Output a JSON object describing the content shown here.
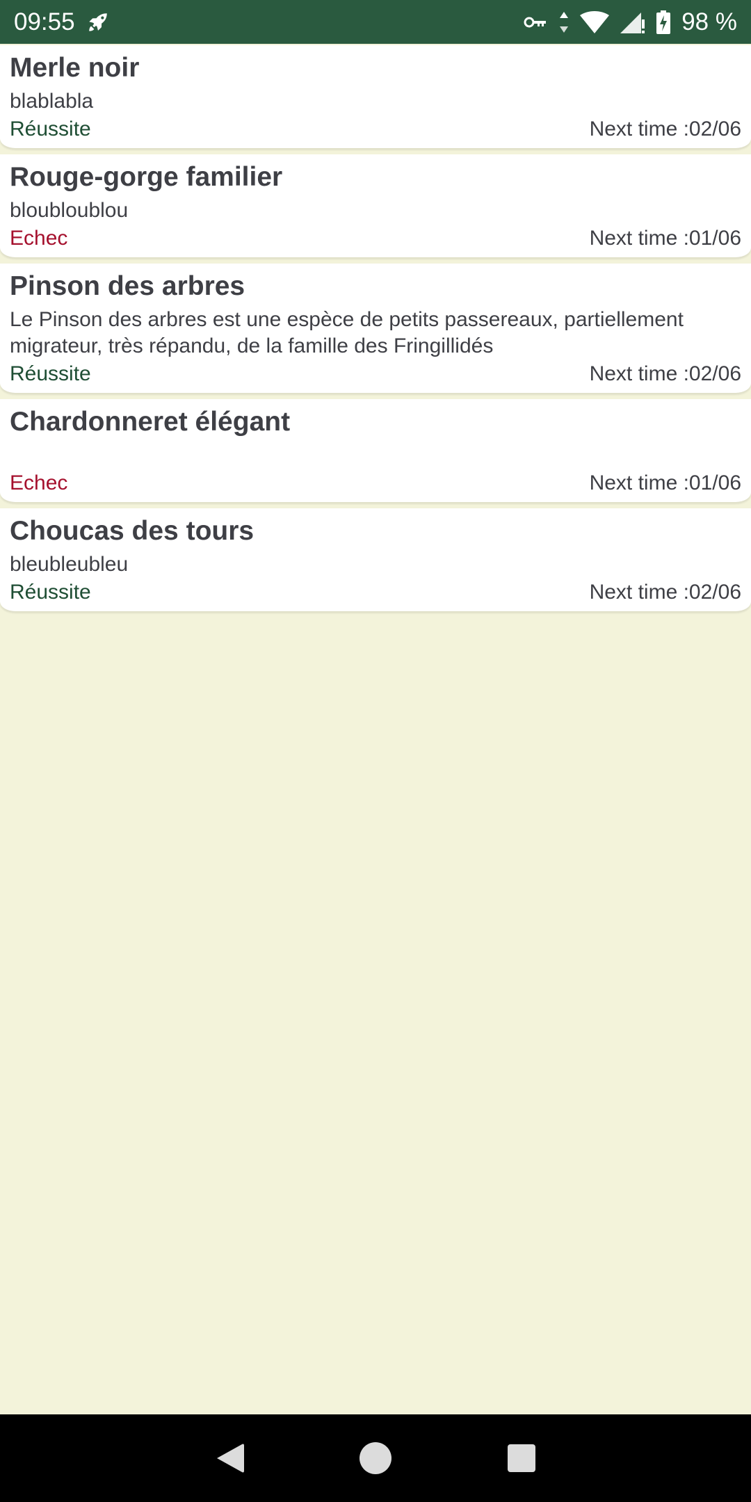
{
  "status_bar": {
    "time": "09:55",
    "battery": "98 %",
    "icons": [
      "rocket-icon",
      "vpn-key-icon",
      "data-arrows-icon",
      "wifi-icon",
      "signal-icon",
      "battery-charging-icon"
    ]
  },
  "colors": {
    "status_bar_bg": "#2a5a3f",
    "page_bg": "#f3f3da",
    "success": "#1f4e34",
    "failure": "#a5102d",
    "text": "#3e3f45"
  },
  "birds": [
    {
      "name": "Merle noir",
      "description": "blablabla",
      "result": "Réussite",
      "next": "Next time :02/06"
    },
    {
      "name": "Rouge-gorge familier",
      "description": "bloubloublou",
      "result": "Echec",
      "next": "Next time :01/06"
    },
    {
      "name": "Pinson des arbres",
      "description": "Le Pinson des arbres est une espèce de petits passereaux, partiellement migrateur, très répandu, de la famille des Fringillidés",
      "result": "Réussite",
      "next": "Next time :02/06"
    },
    {
      "name": "Chardonneret élégant",
      "description": "",
      "result": "Echec",
      "next": "Next time :01/06"
    },
    {
      "name": "Choucas des tours",
      "description": "bleubleubleu",
      "result": "Réussite",
      "next": "Next time :02/06"
    }
  ],
  "nav_bar": {
    "icons": [
      "back-icon",
      "home-icon",
      "recents-icon"
    ]
  }
}
